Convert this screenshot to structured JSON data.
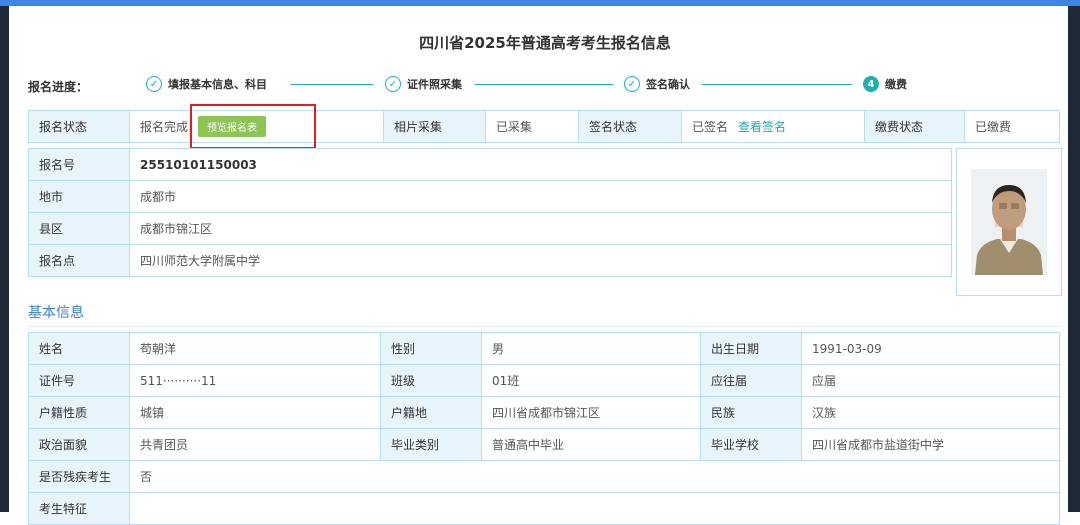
{
  "page": {
    "title": "四川省2025年普通高考考生报名信息"
  },
  "progress": {
    "label": "报名进度：",
    "steps": [
      {
        "label": "填报基本信息、科目",
        "icon": "check-circle-icon"
      },
      {
        "label": "证件照采集",
        "icon": "check-circle-icon"
      },
      {
        "label": "签名确认",
        "icon": "check-circle-icon"
      },
      {
        "label": "缴费",
        "number": "4"
      }
    ]
  },
  "status": {
    "label": "报名状态",
    "value": "报名完成",
    "preview_button": "预览报名表",
    "photo_label": "相片采集",
    "photo_value": "已采集",
    "sign_label": "签名状态",
    "sign_value": "已签名",
    "sign_link": "查看签名",
    "pay_label": "缴费状态",
    "pay_value": "已缴费"
  },
  "registration": [
    {
      "label": "报名号",
      "value": "25510101150003"
    },
    {
      "label": "地市",
      "value": "成都市"
    },
    {
      "label": "县区",
      "value": "成都市锦江区"
    },
    {
      "label": "报名点",
      "value": "四川师范大学附属中学"
    }
  ],
  "basic": {
    "section_title": "基本信息",
    "rows": [
      [
        {
          "label": "姓名",
          "value": "苟朝洋"
        },
        {
          "label": "性别",
          "value": "男"
        },
        {
          "label": "出生日期",
          "value": "1991-03-09"
        }
      ],
      [
        {
          "label": "证件号",
          "value": "511··········11"
        },
        {
          "label": "班级",
          "value": "01班"
        },
        {
          "label": "应往届",
          "value": "应届"
        }
      ],
      [
        {
          "label": "户籍性质",
          "value": "城镇"
        },
        {
          "label": "户籍地",
          "value": "四川省成都市锦江区"
        },
        {
          "label": "民族",
          "value": "汉族"
        }
      ],
      [
        {
          "label": "政治面貌",
          "value": "共青团员"
        },
        {
          "label": "毕业类别",
          "value": "普通高中毕业"
        },
        {
          "label": "毕业学校",
          "value": "四川省成都市盐道街中学"
        }
      ]
    ],
    "disabled_label": "是否残疾考生",
    "disabled_value": "否",
    "next_label": "考生特征"
  },
  "colors": {
    "accent": "#1eb0b0",
    "label_bg": "#e8f4fb",
    "border": "#b8dff0",
    "button": "#8dc454",
    "highlight": "#e02020"
  }
}
